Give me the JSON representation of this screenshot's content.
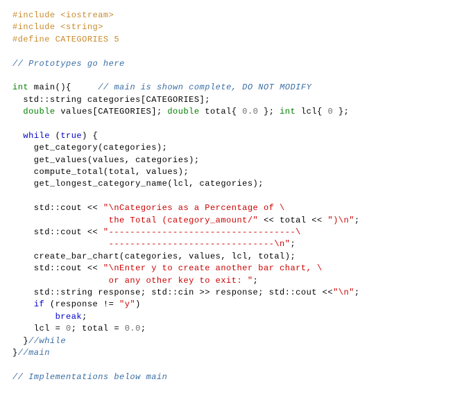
{
  "lines": [
    {
      "spans": [
        {
          "cls": "pp",
          "text": "#include <iostream>"
        }
      ]
    },
    {
      "spans": [
        {
          "cls": "pp",
          "text": "#include <string>"
        }
      ]
    },
    {
      "spans": [
        {
          "cls": "pp",
          "text": "#define CATEGORIES 5"
        }
      ]
    },
    {
      "spans": [
        {
          "cls": "id",
          "text": ""
        }
      ]
    },
    {
      "spans": [
        {
          "cls": "cm",
          "text": "// Prototypes go here"
        }
      ]
    },
    {
      "spans": [
        {
          "cls": "id",
          "text": ""
        }
      ]
    },
    {
      "spans": [
        {
          "cls": "kw",
          "text": "int"
        },
        {
          "cls": "id",
          "text": " main(){     "
        },
        {
          "cls": "cm",
          "text": "// main is shown complete, DO NOT MODIFY"
        }
      ]
    },
    {
      "spans": [
        {
          "cls": "id",
          "text": "  std::string categories[CATEGORIES];"
        }
      ]
    },
    {
      "spans": [
        {
          "cls": "id",
          "text": "  "
        },
        {
          "cls": "kw",
          "text": "double"
        },
        {
          "cls": "id",
          "text": " values[CATEGORIES]; "
        },
        {
          "cls": "kw",
          "text": "double"
        },
        {
          "cls": "id",
          "text": " total{ "
        },
        {
          "cls": "num",
          "text": "0.0"
        },
        {
          "cls": "id",
          "text": " }; "
        },
        {
          "cls": "kw",
          "text": "int"
        },
        {
          "cls": "id",
          "text": " lcl{ "
        },
        {
          "cls": "num",
          "text": "0"
        },
        {
          "cls": "id",
          "text": " };"
        }
      ]
    },
    {
      "spans": [
        {
          "cls": "id",
          "text": ""
        }
      ]
    },
    {
      "spans": [
        {
          "cls": "id",
          "text": "  "
        },
        {
          "cls": "bl",
          "text": "while"
        },
        {
          "cls": "id",
          "text": " ("
        },
        {
          "cls": "bl",
          "text": "true"
        },
        {
          "cls": "id",
          "text": ") {"
        }
      ]
    },
    {
      "spans": [
        {
          "cls": "id",
          "text": "    get_category(categories);"
        }
      ]
    },
    {
      "spans": [
        {
          "cls": "id",
          "text": "    get_values(values, categories);"
        }
      ]
    },
    {
      "spans": [
        {
          "cls": "id",
          "text": "    compute_total(total, values);"
        }
      ]
    },
    {
      "spans": [
        {
          "cls": "id",
          "text": "    get_longest_category_name(lcl, categories);"
        }
      ]
    },
    {
      "spans": [
        {
          "cls": "id",
          "text": ""
        }
      ]
    },
    {
      "spans": [
        {
          "cls": "id",
          "text": "    std::cout << "
        },
        {
          "cls": "str",
          "text": "\"\\nCategories as a Percentage of \\"
        }
      ]
    },
    {
      "spans": [
        {
          "cls": "str",
          "text": "                  the Total (category_amount/\""
        },
        {
          "cls": "id",
          "text": " << total << "
        },
        {
          "cls": "str",
          "text": "\")\\n\""
        },
        {
          "cls": "id",
          "text": ";"
        }
      ]
    },
    {
      "spans": [
        {
          "cls": "id",
          "text": "    std::cout << "
        },
        {
          "cls": "str",
          "text": "\"-----------------------------------\\"
        }
      ]
    },
    {
      "spans": [
        {
          "cls": "str",
          "text": "                  -------------------------------\\n\""
        },
        {
          "cls": "id",
          "text": ";"
        }
      ]
    },
    {
      "spans": [
        {
          "cls": "id",
          "text": "    create_bar_chart(categories, values, lcl, total);"
        }
      ]
    },
    {
      "spans": [
        {
          "cls": "id",
          "text": "    std::cout << "
        },
        {
          "cls": "str",
          "text": "\"\\nEnter y to create another bar chart, \\"
        }
      ]
    },
    {
      "spans": [
        {
          "cls": "str",
          "text": "                  or any other key to exit: \""
        },
        {
          "cls": "id",
          "text": ";"
        }
      ]
    },
    {
      "spans": [
        {
          "cls": "id",
          "text": "    std::string response; std::cin >> response; std::cout <<"
        },
        {
          "cls": "str",
          "text": "\"\\n\""
        },
        {
          "cls": "id",
          "text": ";"
        }
      ]
    },
    {
      "spans": [
        {
          "cls": "id",
          "text": "    "
        },
        {
          "cls": "bl",
          "text": "if"
        },
        {
          "cls": "id",
          "text": " (response != "
        },
        {
          "cls": "str",
          "text": "\"y\""
        },
        {
          "cls": "id",
          "text": ")"
        }
      ]
    },
    {
      "spans": [
        {
          "cls": "id",
          "text": "        "
        },
        {
          "cls": "bl",
          "text": "break"
        },
        {
          "cls": "id",
          "text": ";"
        }
      ]
    },
    {
      "spans": [
        {
          "cls": "id",
          "text": "    lcl = "
        },
        {
          "cls": "num",
          "text": "0"
        },
        {
          "cls": "id",
          "text": "; total = "
        },
        {
          "cls": "num",
          "text": "0.0"
        },
        {
          "cls": "id",
          "text": ";"
        }
      ]
    },
    {
      "spans": [
        {
          "cls": "id",
          "text": "  }"
        },
        {
          "cls": "cm",
          "text": "//while"
        }
      ]
    },
    {
      "spans": [
        {
          "cls": "id",
          "text": "}"
        },
        {
          "cls": "cm",
          "text": "//main"
        }
      ]
    },
    {
      "spans": [
        {
          "cls": "id",
          "text": ""
        }
      ]
    },
    {
      "spans": [
        {
          "cls": "cm",
          "text": "// Implementations below main"
        }
      ]
    }
  ]
}
